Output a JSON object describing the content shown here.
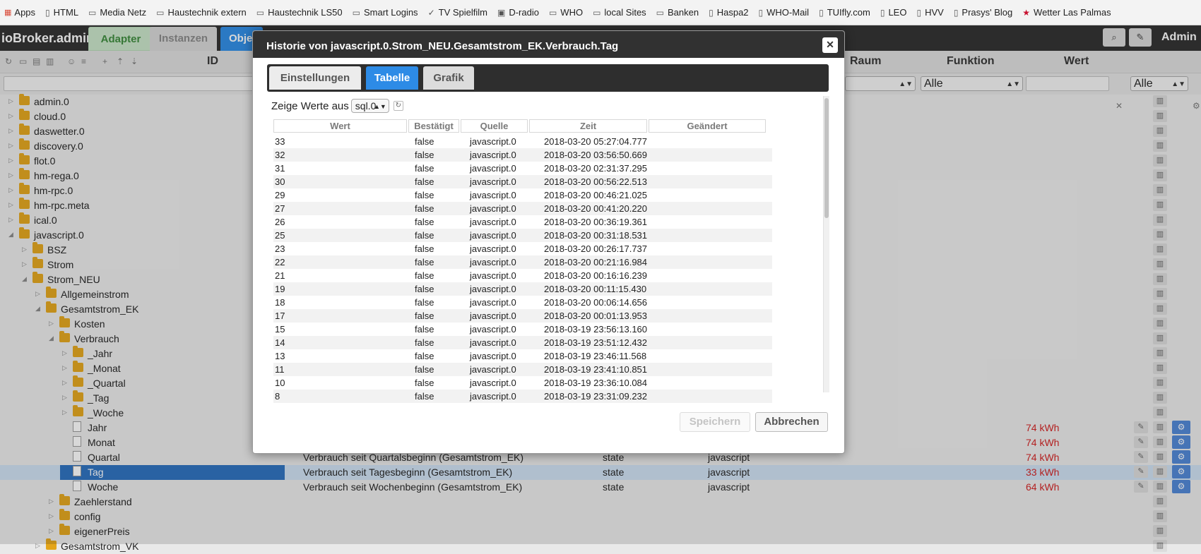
{
  "bookmarks": [
    {
      "label": "Apps",
      "icon": "apps-grid-icon"
    },
    {
      "label": "HTML",
      "icon": "page-icon"
    },
    {
      "label": "Media Netz",
      "icon": "folder-icon"
    },
    {
      "label": "Haustechnik extern",
      "icon": "folder-icon"
    },
    {
      "label": "Haustechnik LS50",
      "icon": "folder-icon"
    },
    {
      "label": "Smart Logins",
      "icon": "folder-icon"
    },
    {
      "label": "TV Spielfilm",
      "icon": "tv-icon"
    },
    {
      "label": "D-radio",
      "icon": "radio-icon"
    },
    {
      "label": "WHO",
      "icon": "folder-icon"
    },
    {
      "label": "local Sites",
      "icon": "folder-icon"
    },
    {
      "label": "Banken",
      "icon": "folder-icon"
    },
    {
      "label": "Haspa2",
      "icon": "page-icon"
    },
    {
      "label": "WHO-Mail",
      "icon": "page-icon"
    },
    {
      "label": "TUIfly.com",
      "icon": "page-icon"
    },
    {
      "label": "LEO",
      "icon": "page-icon"
    },
    {
      "label": "HVV",
      "icon": "page-icon"
    },
    {
      "label": "Prasys' Blog",
      "icon": "page-icon"
    },
    {
      "label": "Wetter Las Palmas",
      "icon": "star-icon"
    }
  ],
  "app": {
    "brand": "ioBroker.admin",
    "tabs": [
      "Adapter",
      "Instanzen",
      "Obje"
    ],
    "user": "Admin"
  },
  "columns": {
    "id": "ID",
    "raum": "Raum",
    "funktion": "Funktion",
    "wert": "Wert"
  },
  "filters": {
    "raum": "",
    "funktion": "Alle",
    "wert": "",
    "wert_sel": "Alle"
  },
  "tree": [
    {
      "label": "admin.0",
      "indent": 0,
      "kind": "folder",
      "toggle": "▷"
    },
    {
      "label": "cloud.0",
      "indent": 0,
      "kind": "folder",
      "toggle": "▷"
    },
    {
      "label": "daswetter.0",
      "indent": 0,
      "kind": "folder",
      "toggle": "▷"
    },
    {
      "label": "discovery.0",
      "indent": 0,
      "kind": "folder",
      "toggle": "▷"
    },
    {
      "label": "flot.0",
      "indent": 0,
      "kind": "folder",
      "toggle": "▷"
    },
    {
      "label": "hm-rega.0",
      "indent": 0,
      "kind": "folder",
      "toggle": "▷"
    },
    {
      "label": "hm-rpc.0",
      "indent": 0,
      "kind": "folder",
      "toggle": "▷"
    },
    {
      "label": "hm-rpc.meta",
      "indent": 0,
      "kind": "folder",
      "toggle": "▷"
    },
    {
      "label": "ical.0",
      "indent": 0,
      "kind": "folder",
      "toggle": "▷"
    },
    {
      "label": "javascript.0",
      "indent": 0,
      "kind": "folder",
      "toggle": "◢"
    },
    {
      "label": "BSZ",
      "indent": 1,
      "kind": "folder",
      "toggle": "▷"
    },
    {
      "label": "Strom",
      "indent": 1,
      "kind": "folder",
      "toggle": "▷"
    },
    {
      "label": "Strom_NEU",
      "indent": 1,
      "kind": "folder",
      "toggle": "◢"
    },
    {
      "label": "Allgemeinstrom",
      "indent": 2,
      "kind": "folder",
      "toggle": "▷"
    },
    {
      "label": "Gesamtstrom_EK",
      "indent": 2,
      "kind": "folder",
      "toggle": "◢"
    },
    {
      "label": "Kosten",
      "indent": 3,
      "kind": "folder",
      "toggle": "▷"
    },
    {
      "label": "Verbrauch",
      "indent": 3,
      "kind": "folder",
      "toggle": "◢"
    },
    {
      "label": "_Jahr",
      "indent": 4,
      "kind": "folder",
      "toggle": "▷"
    },
    {
      "label": "_Monat",
      "indent": 4,
      "kind": "folder",
      "toggle": "▷"
    },
    {
      "label": "_Quartal",
      "indent": 4,
      "kind": "folder",
      "toggle": "▷"
    },
    {
      "label": "_Tag",
      "indent": 4,
      "kind": "folder",
      "toggle": "▷"
    },
    {
      "label": "_Woche",
      "indent": 4,
      "kind": "folder",
      "toggle": "▷"
    },
    {
      "label": "Jahr",
      "indent": 4,
      "kind": "file",
      "toggle": "",
      "desc": "",
      "type": "",
      "role": "",
      "value": "74 kWh"
    },
    {
      "label": "Monat",
      "indent": 4,
      "kind": "file",
      "toggle": "",
      "desc": "",
      "type": "",
      "role": "",
      "value": "74 kWh"
    },
    {
      "label": "Quartal",
      "indent": 4,
      "kind": "file",
      "toggle": "",
      "desc": "Verbrauch seit Quartalsbeginn (Gesamtstrom_EK)",
      "type": "state",
      "role": "javascript",
      "value": "74 kWh"
    },
    {
      "label": "Tag",
      "indent": 4,
      "kind": "file",
      "toggle": "",
      "desc": "Verbrauch seit Tagesbeginn (Gesamtstrom_EK)",
      "type": "state",
      "role": "javascript",
      "value": "33 kWh",
      "selected": true
    },
    {
      "label": "Woche",
      "indent": 4,
      "kind": "file",
      "toggle": "",
      "desc": "Verbrauch seit Wochenbeginn (Gesamtstrom_EK)",
      "type": "state",
      "role": "javascript",
      "value": "64 kWh"
    },
    {
      "label": "Zaehlerstand",
      "indent": 3,
      "kind": "folder",
      "toggle": "▷"
    },
    {
      "label": "config",
      "indent": 3,
      "kind": "folder",
      "toggle": "▷"
    },
    {
      "label": "eigenerPreis",
      "indent": 3,
      "kind": "folder",
      "toggle": "▷"
    },
    {
      "label": "Gesamtstrom_VK",
      "indent": 2,
      "kind": "folder",
      "toggle": "▷"
    }
  ],
  "dialog": {
    "title": "Historie von javascript.0.Strom_NEU.Gesamtstrom_EK.Verbrauch.Tag",
    "tabs": {
      "settings": "Einstellungen",
      "table": "Tabelle",
      "graph": "Grafik"
    },
    "show_values_label": "Zeige Werte aus",
    "source": "sql.0",
    "headers": {
      "wert": "Wert",
      "bestaetigt": "Bestätigt",
      "quelle": "Quelle",
      "zeit": "Zeit",
      "geaendert": "Geändert"
    },
    "rows": [
      {
        "wert": "33",
        "ack": "false",
        "src": "javascript.0",
        "ts": "2018-03-20 05:27:04.777"
      },
      {
        "wert": "32",
        "ack": "false",
        "src": "javascript.0",
        "ts": "2018-03-20 03:56:50.669"
      },
      {
        "wert": "31",
        "ack": "false",
        "src": "javascript.0",
        "ts": "2018-03-20 02:31:37.295"
      },
      {
        "wert": "30",
        "ack": "false",
        "src": "javascript.0",
        "ts": "2018-03-20 00:56:22.513"
      },
      {
        "wert": "29",
        "ack": "false",
        "src": "javascript.0",
        "ts": "2018-03-20 00:46:21.025"
      },
      {
        "wert": "27",
        "ack": "false",
        "src": "javascript.0",
        "ts": "2018-03-20 00:41:20.220"
      },
      {
        "wert": "26",
        "ack": "false",
        "src": "javascript.0",
        "ts": "2018-03-20 00:36:19.361"
      },
      {
        "wert": "25",
        "ack": "false",
        "src": "javascript.0",
        "ts": "2018-03-20 00:31:18.531"
      },
      {
        "wert": "23",
        "ack": "false",
        "src": "javascript.0",
        "ts": "2018-03-20 00:26:17.737"
      },
      {
        "wert": "22",
        "ack": "false",
        "src": "javascript.0",
        "ts": "2018-03-20 00:21:16.984"
      },
      {
        "wert": "21",
        "ack": "false",
        "src": "javascript.0",
        "ts": "2018-03-20 00:16:16.239"
      },
      {
        "wert": "19",
        "ack": "false",
        "src": "javascript.0",
        "ts": "2018-03-20 00:11:15.430"
      },
      {
        "wert": "18",
        "ack": "false",
        "src": "javascript.0",
        "ts": "2018-03-20 00:06:14.656"
      },
      {
        "wert": "17",
        "ack": "false",
        "src": "javascript.0",
        "ts": "2018-03-20 00:01:13.953"
      },
      {
        "wert": "15",
        "ack": "false",
        "src": "javascript.0",
        "ts": "2018-03-19 23:56:13.160"
      },
      {
        "wert": "14",
        "ack": "false",
        "src": "javascript.0",
        "ts": "2018-03-19 23:51:12.432"
      },
      {
        "wert": "13",
        "ack": "false",
        "src": "javascript.0",
        "ts": "2018-03-19 23:46:11.568"
      },
      {
        "wert": "11",
        "ack": "false",
        "src": "javascript.0",
        "ts": "2018-03-19 23:41:10.851"
      },
      {
        "wert": "10",
        "ack": "false",
        "src": "javascript.0",
        "ts": "2018-03-19 23:36:10.084"
      },
      {
        "wert": "8",
        "ack": "false",
        "src": "javascript.0",
        "ts": "2018-03-19 23:31:09.232"
      }
    ],
    "save_label": "Speichern",
    "cancel_label": "Abbrechen"
  },
  "colors": {
    "accent": "#2d8be6",
    "value_red": "#d21f1f",
    "folder": "#e3a51a"
  }
}
